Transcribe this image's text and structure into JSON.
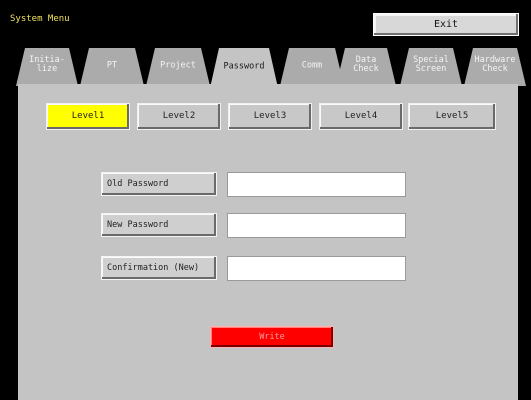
{
  "window": {
    "title": "System Menu"
  },
  "header": {
    "exit_label": "Exit"
  },
  "tabs": [
    {
      "label": "Initia-\nlize",
      "active": false
    },
    {
      "label": "PT",
      "active": false
    },
    {
      "label": "Project",
      "active": false
    },
    {
      "label": "Password",
      "active": true
    },
    {
      "label": "Comm",
      "active": false
    },
    {
      "label": "Data\nCheck",
      "active": false
    },
    {
      "label": "Special\nScreen",
      "active": false
    },
    {
      "label": "Hardware\nCheck",
      "active": false
    }
  ],
  "levels": [
    {
      "label": "Level1",
      "selected": true
    },
    {
      "label": "Level2",
      "selected": false
    },
    {
      "label": "Level3",
      "selected": false
    },
    {
      "label": "Level4",
      "selected": false
    },
    {
      "label": "Level5",
      "selected": false
    }
  ],
  "form": {
    "old_password": {
      "label": "Old Password",
      "value": ""
    },
    "new_password": {
      "label": "New Password",
      "value": ""
    },
    "confirmation": {
      "label": "Confirmation (New)",
      "value": ""
    }
  },
  "actions": {
    "write_label": "Write"
  },
  "colors": {
    "background": "#000000",
    "title": "#f0e060",
    "panel": "#c4c4c4",
    "tab_inactive": "#ababab",
    "level_selected": "#ffff00",
    "write": "#ff0000"
  }
}
